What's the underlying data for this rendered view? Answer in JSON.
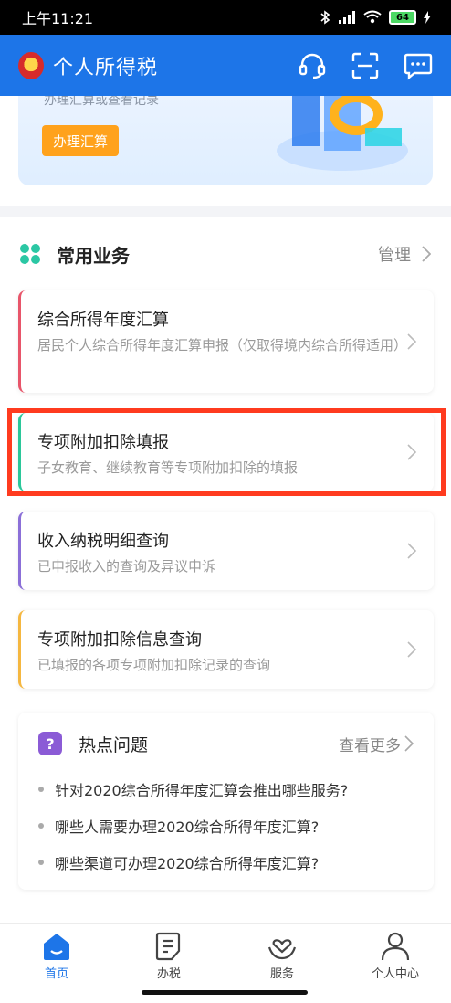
{
  "status_bar": {
    "time": "上午11:21",
    "battery": "64"
  },
  "header": {
    "title": "个人所得税"
  },
  "banner": {
    "subtitle": "办理汇算或查看记录",
    "button_label": "办理汇算"
  },
  "common": {
    "title": "常用业务",
    "manage_label": "管理",
    "items": [
      {
        "title": "综合所得年度汇算",
        "desc": "居民个人综合所得年度汇算申报（仅取得境内综合所得适用）",
        "accent": "#e8556a"
      },
      {
        "title": "专项附加扣除填报",
        "desc": "子女教育、继续教育等专项附加扣除的填报",
        "accent": "#2bc79a"
      },
      {
        "title": "收入纳税明细查询",
        "desc": "已申报收入的查询及异议申诉",
        "accent": "#8b6fd8"
      },
      {
        "title": "专项附加扣除信息查询",
        "desc": "已填报的各项专项附加扣除记录的查询",
        "accent": "#f5b740"
      }
    ]
  },
  "hot": {
    "title": "热点问题",
    "more_label": "查看更多",
    "questions": [
      "针对2020综合所得年度汇算会推出哪些服务?",
      "哪些人需要办理2020综合所得年度汇算?",
      "哪些渠道可办理2020综合所得年度汇算?"
    ]
  },
  "nav": {
    "items": [
      {
        "label": "首页",
        "icon": "home-icon"
      },
      {
        "label": "办税",
        "icon": "tax-doc-icon"
      },
      {
        "label": "服务",
        "icon": "heart-hands-icon"
      },
      {
        "label": "个人中心",
        "icon": "person-icon"
      }
    ]
  },
  "colors": {
    "brand": "#1d75e8",
    "highlight": "#ff3b1f",
    "button": "#ffa21c"
  }
}
